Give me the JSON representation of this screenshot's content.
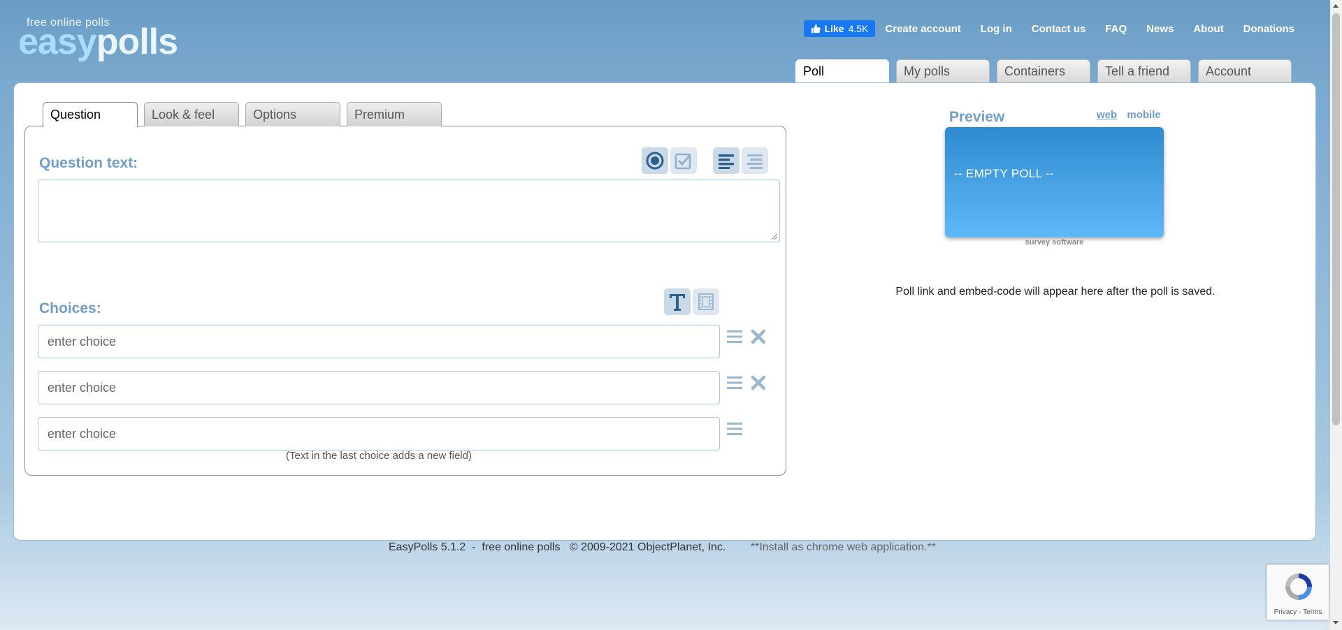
{
  "logo": {
    "tagline": "free online polls",
    "brand_part1": "easy",
    "brand_part2": "polls"
  },
  "topnav": {
    "like_label": "Like",
    "like_count": "4.5K",
    "links": [
      "Create account",
      "Log in",
      "Contact us",
      "FAQ",
      "News",
      "About",
      "Donations"
    ]
  },
  "main_tabs": [
    "Poll",
    "My polls",
    "Containers",
    "Tell a friend",
    "Account"
  ],
  "main_tab_active": "Poll",
  "sub_tabs": [
    "Question",
    "Look & feel",
    "Options",
    "Premium"
  ],
  "sub_tab_active": "Question",
  "question": {
    "label": "Question text:",
    "value": ""
  },
  "choices": {
    "label": "Choices:",
    "placeholder": "enter choice",
    "count": 3,
    "hint": "(Text in the last choice adds a new field)"
  },
  "preview": {
    "label": "Preview",
    "link_web": "web",
    "link_mobile": "mobile",
    "empty_text": "-- EMPTY POLL --",
    "credit": "survey software",
    "embed_message": "Poll link and embed-code will appear here after the poll is saved."
  },
  "footer": {
    "version": "EasyPolls 5.1.2",
    "tagline": "free online polls",
    "copyright": "© 2009-2021 ObjectPlanet, Inc.",
    "install": "**Install as chrome web application.**"
  },
  "recaptcha": {
    "privacy": "Privacy",
    "terms": "Terms"
  },
  "colors": {
    "accent_blue": "#6f9fc6",
    "preview_top": "#2f8bd0",
    "preview_bottom": "#5fb8f6",
    "fb_blue": "#1877f2"
  },
  "icons": {
    "question_type": [
      "single-choice-icon",
      "multiple-choice-icon"
    ],
    "layout": [
      "vertical-layout-icon",
      "horizontal-layout-icon"
    ],
    "choice_type": [
      "text-type-icon",
      "media-type-icon"
    ],
    "row": [
      "drag-handle-icon",
      "delete-icon"
    ]
  }
}
